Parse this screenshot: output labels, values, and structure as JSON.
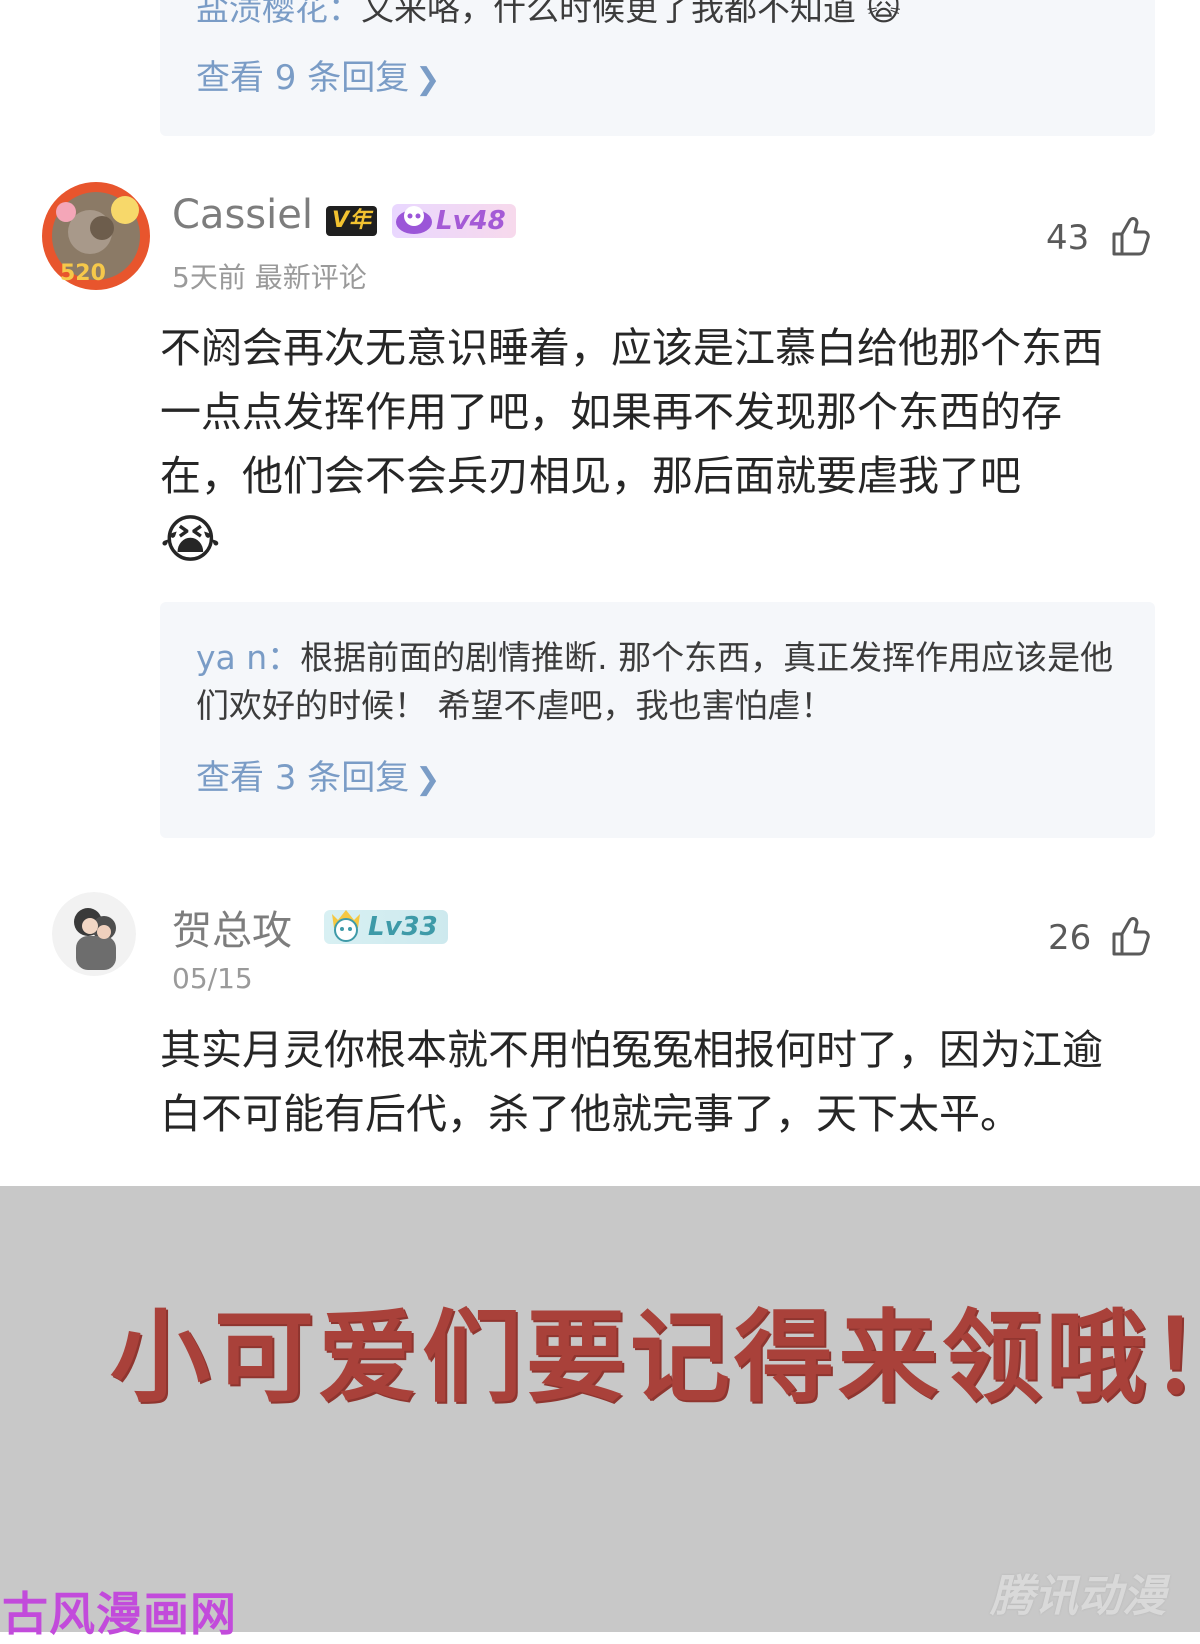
{
  "top_reply": {
    "user": "盐渍樱花：",
    "text": "又来咯，什么时候更了我都不知道",
    "emoji": "🙀",
    "view_replies": "查看 9 条回复"
  },
  "comments": [
    {
      "username": "Cassiel",
      "vip_badge": "V年",
      "level_badge": "Lv48",
      "time": "5天前",
      "tag": "最新评论",
      "likes": "43",
      "body": "不阏会再次无意识睡着，应该是江慕白给他那个东西一点点发挥作用了吧，如果再不发现那个东西的存在，他们会不会兵刃相见，那后面就要虐我了吧",
      "emoji": "😭",
      "reply": {
        "user": "ya n：",
        "text": "根据前面的剧情推断. 那个东西，真正发挥作用应该是他们欢好的时候！ 希望不虐吧，我也害怕虐！",
        "view_replies": "查看 3 条回复"
      }
    },
    {
      "username": "贺总攻",
      "level_badge": "Lv33",
      "time": "05/15",
      "likes": "26",
      "body": "其实月灵你根本就不用怕冤冤相报何时了，因为江逾白不可能有后代，杀了他就完事了，天下太平。"
    }
  ],
  "banner": {
    "text": "小可爱们要记得来领哦！"
  },
  "watermarks": {
    "left": "古风漫画网",
    "right": "腾讯动漫"
  },
  "colors": {
    "link_blue": "#7a9cc6",
    "banner_gray": "#c8c8c8",
    "banner_text": "#a9413a"
  }
}
